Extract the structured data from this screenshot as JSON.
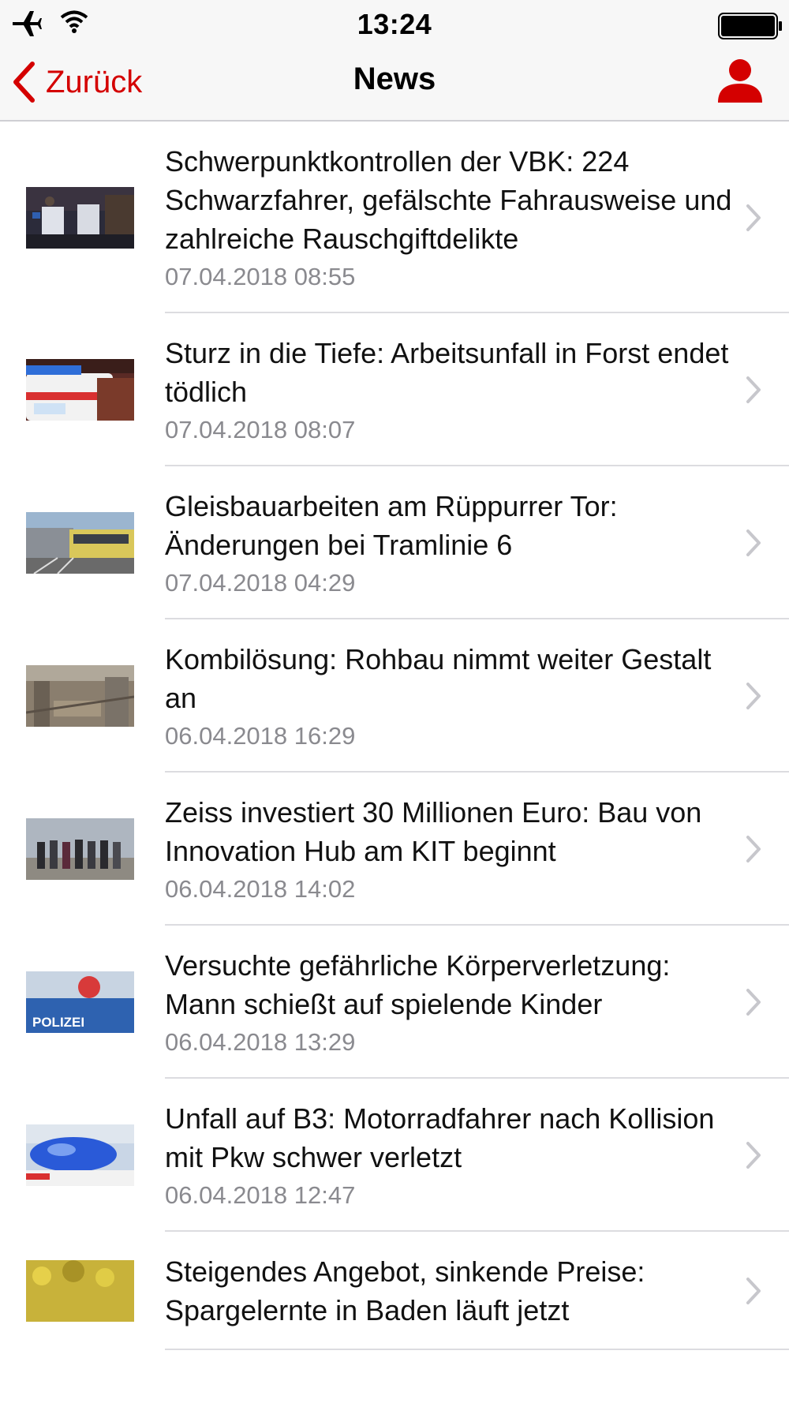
{
  "status_bar": {
    "time": "13:24"
  },
  "nav": {
    "back_label": "Zurück",
    "title": "News"
  },
  "colors": {
    "accent": "#d40000",
    "meta_text": "#8a8a8f",
    "separator": "#dcdce0",
    "bar_background": "#f7f7f7"
  },
  "icons": {
    "airplane": "airplane-icon",
    "wifi": "wifi-icon",
    "battery": "battery-icon",
    "back": "chevron-left-icon",
    "profile": "user-profile-icon",
    "row": "chevron-right-icon"
  },
  "news": [
    {
      "title": "Schwerpunktkontrollen der VBK: 224 Schwarzfahrer, gefälschte Fahrausweise und zahlreiche Rauschgiftdelikte",
      "date": "07.04.2018 08:55",
      "thumb": "police-night"
    },
    {
      "title": "Sturz in die Tiefe: Arbeitsunfall in Forst endet tödlich",
      "date": "07.04.2018 08:07",
      "thumb": "ambulance"
    },
    {
      "title": "Gleisbauarbeiten am Rüppurrer Tor: Änderungen bei Tramlinie 6",
      "date": "07.04.2018 04:29",
      "thumb": "tram"
    },
    {
      "title": "Kombilösung: Rohbau nimmt weiter Gestalt an",
      "date": "06.04.2018 16:29",
      "thumb": "construction"
    },
    {
      "title": "Zeiss investiert 30 Millionen Euro: Bau von Innovation Hub am KIT beginnt",
      "date": "06.04.2018 14:02",
      "thumb": "group-photo"
    },
    {
      "title": "Versuchte gefährliche Körperverletzung: Mann schießt auf spielende Kinder",
      "date": "06.04.2018 13:29",
      "thumb": "polizei-car",
      "thumb_text": "POLIZEI"
    },
    {
      "title": "Unfall auf B3: Motorradfahrer nach Kollision mit Pkw schwer verletzt",
      "date": "06.04.2018 12:47",
      "thumb": "blue-light"
    },
    {
      "title": "Steigendes Angebot, sinkende Preise: Spargelernte in Baden läuft jetzt",
      "date": "",
      "thumb": "asparagus"
    }
  ]
}
